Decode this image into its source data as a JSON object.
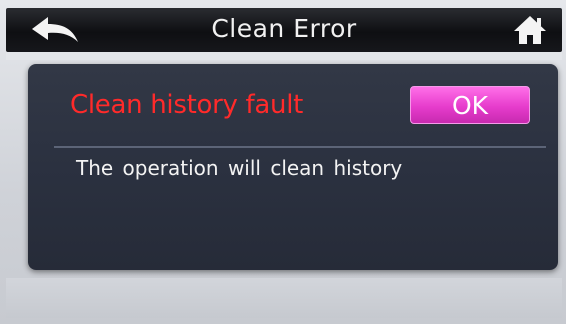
{
  "header": {
    "title": "Clean Error",
    "back_icon": "back-arrow-icon",
    "home_icon": "home-icon"
  },
  "dialog": {
    "title": "Clean history fault",
    "ok_label": "OK",
    "message": "The operation will clean history"
  },
  "colors": {
    "title_text": "#ff2a2a",
    "ok_button": "#e63ccc",
    "dialog_bg": "#2b3140",
    "titlebar_bg": "#0e0f12"
  }
}
